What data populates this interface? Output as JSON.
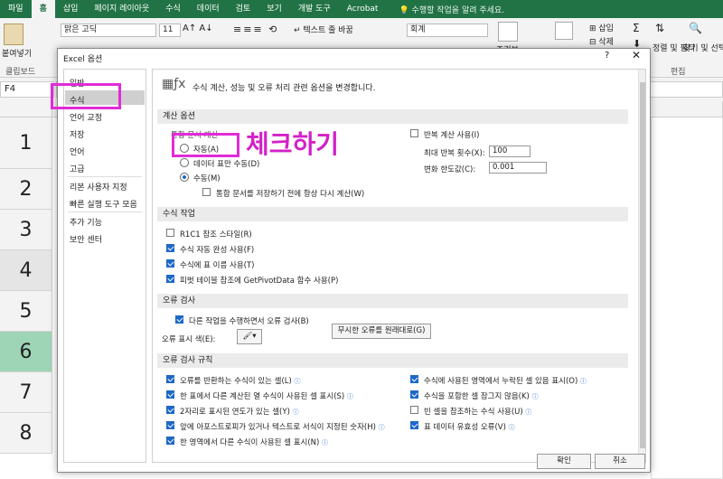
{
  "ribbon_tabs": [
    "파일",
    "홈",
    "삽입",
    "페이지 레이아웃",
    "수식",
    "데이터",
    "검토",
    "보기",
    "개발 도구",
    "Acrobat"
  ],
  "active_tab": "홈",
  "tell_me": "수행할 작업을 알려 주세요.",
  "ribbon": {
    "paste_label": "붙여넣기",
    "clipboard_label": "클립보드",
    "font_name": "맑은 고딕",
    "font_size": "11",
    "wrap_text_label": "텍스트 줄 바꿈",
    "number_format": "회계",
    "conditional_label": "조건부",
    "insert_label": "삽입",
    "delete_label": "삭제",
    "sort_filter_label": "정렬 및 필터",
    "find_select_label": "찾기 및 선택",
    "edit_label": "편집"
  },
  "name_box": "F4",
  "row_numbers": [
    "1",
    "2",
    "3",
    "4",
    "5",
    "6",
    "7",
    "8"
  ],
  "dialog": {
    "title": "Excel 옵션",
    "help": "?",
    "close": "✕",
    "nav_items": [
      "일반",
      "수식",
      "언어 교정",
      "저장",
      "언어",
      "고급",
      "리본 사용자 지정",
      "빠른 실행 도구 모음",
      "추가 기능",
      "보안 센터"
    ],
    "selected_nav": "수식",
    "header_text": "수식 계산, 성능 및 오류 처리 관련 옵션을 변경합니다.",
    "calc_section": {
      "title": "계산 옵션",
      "workbook_calc_label": "통합 문서 계산",
      "auto": "자동(A)",
      "auto_except_tables": "데이터 표만 수동(D)",
      "manual": "수동(M)",
      "recalc_before_save": "통합 문서를 저장하기 전에 항상 다시 계산(W)",
      "iterative": "반복 계산 사용(I)",
      "max_iterations_label": "최대 반복 횟수(X):",
      "max_iterations_value": "100",
      "max_change_label": "변화 한도값(C):",
      "max_change_value": "0.001"
    },
    "formulas_section": {
      "title": "수식 작업",
      "items": [
        {
          "label": "R1C1 참조 스타일(R)",
          "checked": false
        },
        {
          "label": "수식 자동 완성 사용(F)",
          "checked": true
        },
        {
          "label": "수식에 표 이름 사용(T)",
          "checked": true
        },
        {
          "label": "피벗 테이블 참조에 GetPivotData 함수 사용(P)",
          "checked": true
        }
      ]
    },
    "error_check_section": {
      "title": "오류 검사",
      "background_check": "다른 작업을 수행하면서 오류 검사(B)",
      "color_label": "오류 표시 색(E):",
      "reset_button": "무시한 오류를 원래대로(G)"
    },
    "rules_section": {
      "title": "오류 검사 규칙",
      "left": [
        "오류를 반환하는 수식이 있는 셀(L)",
        "한 표에서 다른 계산된 열 수식이 사용된 셀 표시(S)",
        "2자리로 표시된 연도가 있는 셀(Y)",
        "앞에 아포스트로피가 있거나 텍스트로 서식이 지정된 숫자(H)",
        "한 영역에서 다른 수식이 사용된 셀 표시(N)"
      ],
      "right": [
        "수식에 사용된 영역에서 누락된 셀 있음 표시(O)",
        "수식을 포함한 셀 잠그지 않음(K)",
        "빈 셀을 참조하는 수식 사용(U)",
        "표 데이터 유효성 오류(V)"
      ],
      "right_checked": [
        true,
        true,
        false,
        true
      ]
    },
    "ok": "확인",
    "cancel": "취소"
  },
  "annotation": "체크하기",
  "colors": {
    "excel_green": "#217346",
    "highlight": "#e22bd8",
    "checkbox": "#1e68c6"
  }
}
